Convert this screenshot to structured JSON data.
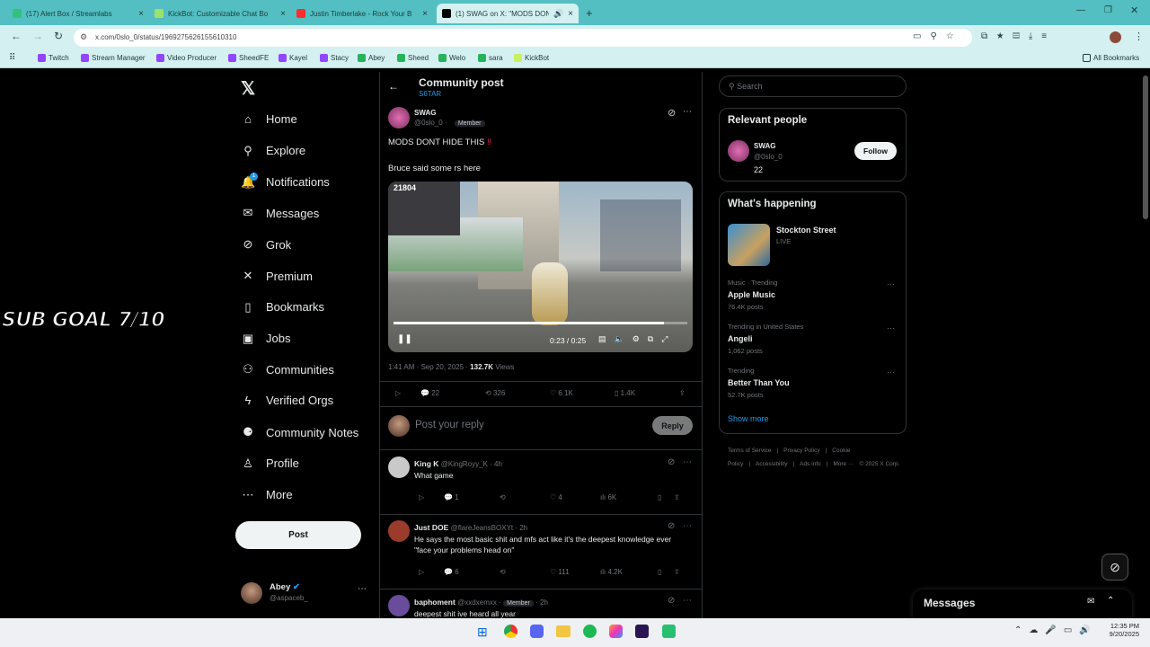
{
  "browser": {
    "tabs": [
      {
        "title": "(17) Alert Box / Streamlabs",
        "color": "#31c27c"
      },
      {
        "title": "KickBot: Customizable Chat Bo",
        "color": "#9be36a"
      },
      {
        "title": "Justin Timberlake - Rock Your B",
        "color": "#ff2d2d"
      },
      {
        "title": "(1) SWAG on X: \"MODS DON'",
        "color": "#000000"
      }
    ],
    "url": "x.com/0slo_0/status/1969275626155610310",
    "bookmarks": [
      "Twitch",
      "Stream Manager",
      "Video Producer",
      "SheedFE",
      "Kayel",
      "Stacy",
      "Abey",
      "Sheed",
      "Welo",
      "sara",
      "KickBot"
    ],
    "all_bookmarks": "All Bookmarks"
  },
  "overlay": {
    "sub_goal": "SUB GOAL 7/10"
  },
  "nav": {
    "items": [
      {
        "label": "Home",
        "icon": "home-icon",
        "glyph": "⌂"
      },
      {
        "label": "Explore",
        "icon": "search-icon",
        "glyph": "⚲"
      },
      {
        "label": "Notifications",
        "icon": "bell-icon",
        "glyph": "🔔"
      },
      {
        "label": "Messages",
        "icon": "mail-icon",
        "glyph": "✉"
      },
      {
        "label": "Grok",
        "icon": "grok-icon",
        "glyph": "⊘"
      },
      {
        "label": "Premium",
        "icon": "x-icon",
        "glyph": "✕"
      },
      {
        "label": "Bookmarks",
        "icon": "bookmark-icon",
        "glyph": "▯"
      },
      {
        "label": "Jobs",
        "icon": "briefcase-icon",
        "glyph": "▣"
      },
      {
        "label": "Communities",
        "icon": "people-icon",
        "glyph": "⚇"
      },
      {
        "label": "Verified Orgs",
        "icon": "bolt-icon",
        "glyph": "ϟ"
      },
      {
        "label": "Community Notes",
        "icon": "notes-icon",
        "glyph": "⚈"
      },
      {
        "label": "Profile",
        "icon": "person-icon",
        "glyph": "♙"
      },
      {
        "label": "More",
        "icon": "more-icon",
        "glyph": "⋯"
      }
    ],
    "notif_badge": "1",
    "post": "Post",
    "account": {
      "name": "Abey",
      "handle": "@aspaceb_"
    }
  },
  "header": {
    "title": "Community post",
    "community": "S6TAR"
  },
  "post": {
    "author": "SWAG",
    "handle": "@0slo_0",
    "role": "Member",
    "line1": "MODS DONT HIDE THIS",
    "emoji": "‼",
    "line2": "Bruce said some rs here",
    "video": {
      "counter": "21804",
      "time": "0:23 / 0:25",
      "progress": 0.92
    },
    "meta_time": "1:41 AM · Sep 20, 2025 · ",
    "views": "132.7K",
    "views_label": "Views",
    "replies": "22",
    "reposts": "326",
    "likes": "6.1K",
    "bookmarks": "1.4K",
    "reply_placeholder": "Post your reply",
    "reply_button": "Reply"
  },
  "replies": [
    {
      "name": "King K",
      "handle": "@KingRoyy_K · 4h",
      "text": "What game",
      "replies": "1",
      "likes": "4",
      "views": "6K",
      "color": "#c9c9c9"
    },
    {
      "name": "Just DOE",
      "handle": "@flareJeansBOXYt · 2h",
      "text": "He says the most basic shit and mfs act like it's the deepest knowledge ever \"face your problems head on\"",
      "replies": "6",
      "likes": "111",
      "views": "4.2K",
      "color": "#9b3b2c"
    },
    {
      "name": "baphoment",
      "handle": "@xxdxemxx ·",
      "role": "Member",
      "time": "· 2h",
      "text": "deepest shit ive heard all year",
      "color": "#6a4c9c"
    }
  ],
  "right": {
    "search": "Search",
    "relevant_title": "Relevant people",
    "person": {
      "name": "SWAG",
      "handle": "@0slo_0",
      "bio": "22",
      "follow": "Follow"
    },
    "happening_title": "What's happening",
    "live": {
      "name": "Stockton Street",
      "status": "LIVE"
    },
    "trends": [
      {
        "cat": "Music · Trending",
        "name": "Apple Music",
        "posts": "76.4K posts"
      },
      {
        "cat": "Trending in United States",
        "name": "Angeli",
        "posts": "1,062 posts"
      },
      {
        "cat": "Trending",
        "name": "Better Than You",
        "posts": "52.7K posts"
      }
    ],
    "show_more": "Show more",
    "footer": [
      "Terms of Service",
      "|",
      "Privacy Policy",
      "|",
      "Cookie Policy",
      "|",
      "Accessibility",
      "|",
      "Ads info",
      "|",
      "More ···",
      "© 2025 X Corp."
    ],
    "messages": "Messages"
  },
  "taskbar": {
    "time": "12:35 PM",
    "date": "9/20/2025"
  }
}
